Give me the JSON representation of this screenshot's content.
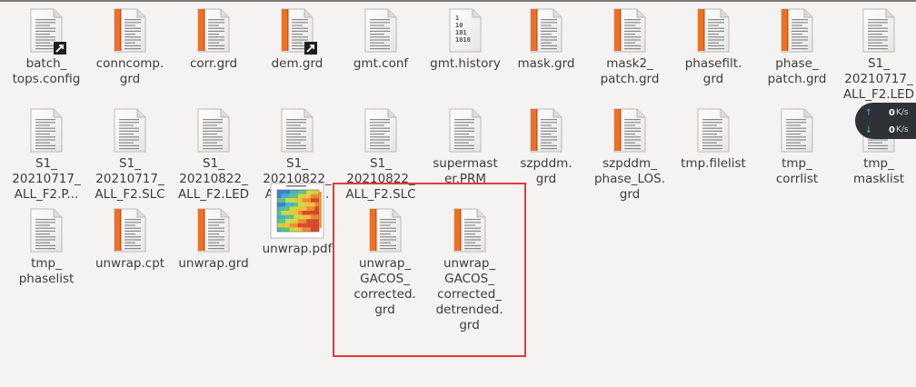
{
  "files": [
    {
      "label": "batch_\ntops.config",
      "icon": "text-document-link-icon"
    },
    {
      "label": "conncomp.\ngrd",
      "icon": "grd-file-icon"
    },
    {
      "label": "corr.grd",
      "icon": "grd-file-icon"
    },
    {
      "label": "dem.grd",
      "icon": "grd-file-link-icon"
    },
    {
      "label": "gmt.conf",
      "icon": "text-document-icon"
    },
    {
      "label": "gmt.history",
      "icon": "binary-file-icon"
    },
    {
      "label": "mask.grd",
      "icon": "grd-file-icon"
    },
    {
      "label": "mask2_\npatch.grd",
      "icon": "grd-file-icon"
    },
    {
      "label": "phasefilt.\ngrd",
      "icon": "grd-file-icon"
    },
    {
      "label": "phase_\npatch.grd",
      "icon": "grd-file-icon"
    },
    {
      "label": "S1_\n20210717_\nALL_F2.LED",
      "icon": "text-document-icon"
    },
    {
      "label": "S1_\n20210717_\nALL_F2.P...",
      "icon": "text-document-icon"
    },
    {
      "label": "S1_\n20210717_\nALL_F2.SLC",
      "icon": "text-document-icon"
    },
    {
      "label": "S1_\n20210822_\nALL_F2.LED",
      "icon": "text-document-icon"
    },
    {
      "label": "S1_\n20210822_\nALL_F2.P...",
      "icon": "text-document-icon"
    },
    {
      "label": "S1_\n20210822_\nALL_F2.SLC",
      "icon": "text-document-icon"
    },
    {
      "label": "supermast\ner.PRM",
      "icon": "text-document-icon"
    },
    {
      "label": "szpddm.\ngrd",
      "icon": "grd-file-icon"
    },
    {
      "label": "szpddm_\nphase_LOS.\ngrd",
      "icon": "grd-file-icon"
    },
    {
      "label": "tmp.filelist",
      "icon": "text-document-icon"
    },
    {
      "label": "tmp_\ncorrlist",
      "icon": "text-document-icon"
    },
    {
      "label": "tmp_\nmasklist",
      "icon": "text-document-icon"
    },
    {
      "label": "tmp_\nphaselist",
      "icon": "text-document-icon"
    },
    {
      "label": "unwrap.cpt",
      "icon": "grd-file-icon"
    },
    {
      "label": "unwrap.grd",
      "icon": "grd-file-icon"
    },
    {
      "label": "unwrap.pdf",
      "icon": "pdf-thumbnail-icon"
    },
    {
      "label": "unwrap_\nGACOS_\ncorrected.\ngrd",
      "icon": "grd-file-icon"
    },
    {
      "label": "unwrap_\nGACOS_\ncorrected_\ndetrended.\ngrd",
      "icon": "grd-file-icon"
    }
  ],
  "binary_icon_text": [
    "1",
    "10",
    "101",
    "1010"
  ],
  "netspeed": {
    "upload_value": "0",
    "upload_unit": "K/s",
    "download_value": "0",
    "download_unit": "K/s",
    "upload_arrow": "↑",
    "download_arrow": "↓"
  },
  "colors": {
    "background": "#f4f3f2",
    "selection_border": "#e53935",
    "grd_stripe": "#e8722a",
    "upload": "#3aa7e6",
    "download": "#4cc46a"
  }
}
